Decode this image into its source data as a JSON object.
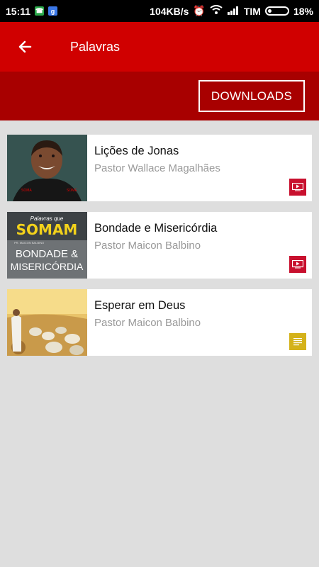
{
  "status": {
    "time": "15:11",
    "speed": "104KB/s",
    "carrier": "TIM",
    "battery": "18%"
  },
  "header": {
    "title": "Palavras"
  },
  "toolbar": {
    "downloads_label": "DOWNLOADS"
  },
  "items": [
    {
      "title": "Lições de Jonas",
      "author": "Pastor Wallace Magalhães",
      "type_icon": "video-icon"
    },
    {
      "title": "Bondade e Misericórdia",
      "author": "Pastor Maicon Balbino",
      "type_icon": "video-icon",
      "thumb_text": [
        "Palavras que",
        "SOMAM",
        "PR. MAICON BALBINO",
        "BONDADE &",
        "MISERICÓRDIA"
      ]
    },
    {
      "title": "Esperar em Deus",
      "author": "Pastor Maicon Balbino",
      "type_icon": "text-icon"
    }
  ],
  "colors": {
    "app_bar": "#d00000",
    "sub_bar": "#a80000",
    "video_icon": "#c8102e",
    "text_icon": "#d4b21a",
    "background": "#dedede"
  }
}
